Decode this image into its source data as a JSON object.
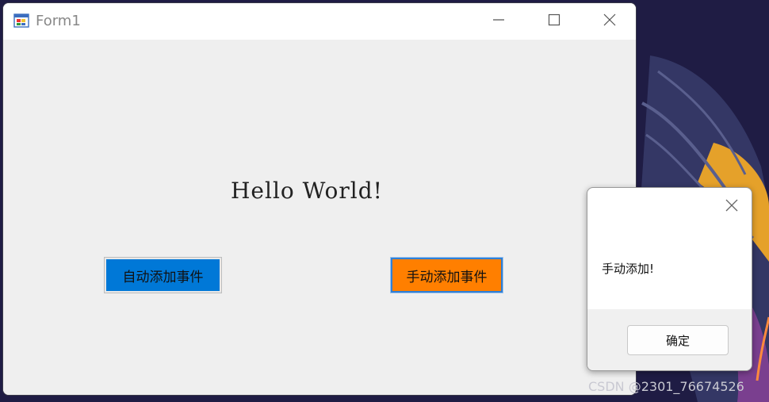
{
  "window": {
    "title": "Form1",
    "hello_text": "Hello World!",
    "buttons": {
      "auto_label": "自动添加事件",
      "manual_label": "手动添加事件"
    }
  },
  "message_box": {
    "text": "手动添加!",
    "ok_label": "确定"
  },
  "watermark": "CSDN @2301_76674526",
  "colors": {
    "auto_button": "#0078d7",
    "manual_button": "#ff7f00",
    "form_background": "#f0f0f0",
    "desktop_background": "#1f1c44"
  },
  "icons": {
    "app": "winforms-app-icon",
    "minimize": "minimize-icon",
    "maximize": "maximize-icon",
    "close": "close-icon"
  }
}
